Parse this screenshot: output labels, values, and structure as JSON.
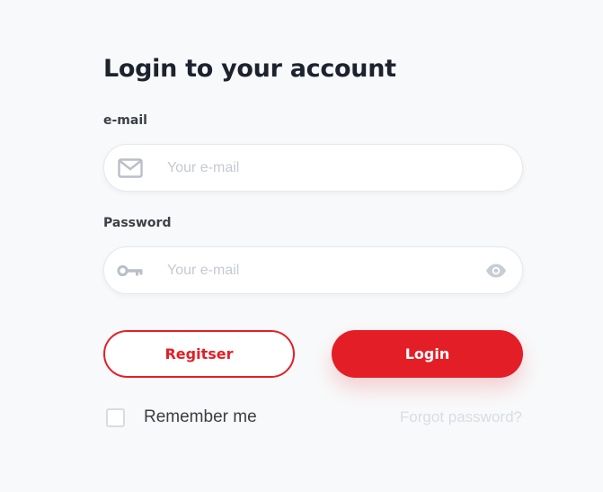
{
  "form": {
    "title": "Login to your account",
    "email": {
      "label": "e-mail",
      "placeholder": "Your e-mail",
      "value": "",
      "icon": "mail-icon"
    },
    "password": {
      "label": "Password",
      "placeholder": "Your e-mail",
      "value": "",
      "icon": "key-icon",
      "toggle_icon": "eye-icon"
    },
    "register_label": "Regitser",
    "login_label": "Login",
    "remember_label": "Remember me",
    "remember_checked": false,
    "forgot_label": "Forgot password?"
  },
  "colors": {
    "accent": "#e41e26",
    "title": "#1c232e",
    "placeholder": "#c5cad2",
    "forgot_link": "#d9dde3",
    "background": "#f8f9fa"
  }
}
